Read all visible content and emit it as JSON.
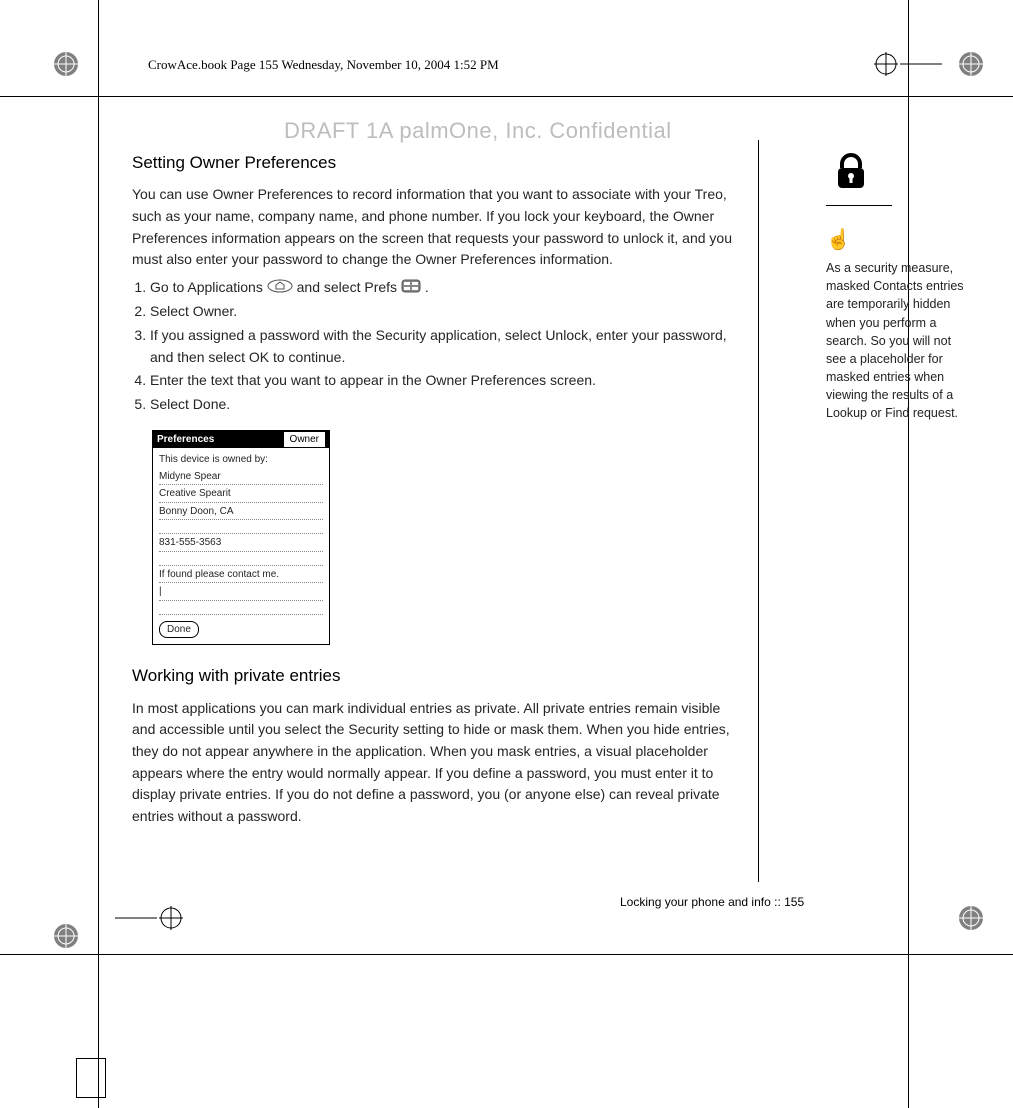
{
  "book_tag": "CrowAce.book  Page 155  Wednesday, November 10, 2004  1:52 PM",
  "watermark": "DRAFT 1A  palmOne, Inc.   Confidential",
  "section1": {
    "heading": "Setting Owner Preferences",
    "para": "You can use Owner Preferences to record information that you want to associate with your Treo, such as your name, company name, and phone number. If you lock your keyboard, the Owner Preferences information appears on the screen that requests your password to unlock it, and you must also enter your password to change the Owner Preferences information.",
    "step1a": "Go to Applications ",
    "step1b": " and select Prefs ",
    "step1c": ".",
    "step2": "Select Owner.",
    "step3": "If you assigned a password with the Security application, select Unlock, enter your password, and then select OK to continue.",
    "step4": "Enter the text that you want to appear in the Owner Preferences screen.",
    "step5": "Select Done."
  },
  "prefs": {
    "title": "Preferences",
    "category": "Owner",
    "l1": "This device is owned by:",
    "l2": "Midyne Spear",
    "l3": "Creative Spearit",
    "l4": "Bonny Doon, CA",
    "l5": "831-555-3563",
    "l6": "If found please contact me.",
    "done": "Done"
  },
  "section2": {
    "heading": "Working with private entries",
    "para": "In most applications you can mark individual entries as private. All private entries remain visible and accessible until you select the Security setting to hide or mask them. When you hide entries, they do not appear anywhere in the application. When you mask entries, a visual placeholder appears where the entry would normally appear. If you define a password, you must enter it to display private entries. If you do not define a password, you (or anyone else) can reveal private entries without a password."
  },
  "sidebar": {
    "tip": "As a security measure, masked Contacts entries are temporarily hidden when you perform a search. So you will not see a placeholder for masked entries when viewing the results of a Lookup or Find request."
  },
  "footer": "Locking your phone and info   ::   155"
}
